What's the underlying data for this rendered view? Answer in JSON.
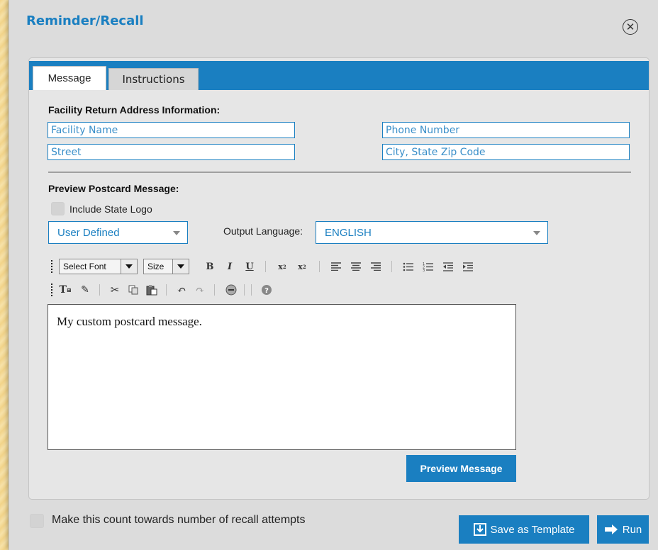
{
  "dialog": {
    "title": "Reminder/Recall",
    "close_icon": "close-circle-icon"
  },
  "tabs": [
    {
      "label": "Message",
      "active": true
    },
    {
      "label": "Instructions",
      "active": false
    }
  ],
  "facility": {
    "section_label": "Facility Return Address Information:",
    "facility_name_placeholder": "Facility Name",
    "phone_placeholder": "Phone Number",
    "street_placeholder": "Street",
    "city_placeholder": "City, State Zip Code"
  },
  "preview": {
    "section_label": "Preview Postcard Message:",
    "include_logo_label": "Include State Logo",
    "include_logo_checked": false,
    "template_select_value": "User Defined",
    "output_language_label": "Output Language:",
    "output_language_value": "ENGLISH"
  },
  "toolbar": {
    "font_select": "Select Font",
    "size_select": "Size",
    "buttons_row1": [
      "bold-icon",
      "italic-icon",
      "underline-icon",
      "subscript-icon",
      "superscript-icon",
      "align-left-icon",
      "align-center-icon",
      "align-right-icon",
      "bullet-list-icon",
      "numbered-list-icon",
      "outdent-icon",
      "indent-icon"
    ],
    "buttons_row2": [
      "text-color-icon",
      "background-color-icon",
      "cut-icon",
      "copy-icon",
      "paste-icon",
      "undo-icon",
      "redo-icon",
      "link-icon",
      "help-icon"
    ]
  },
  "editor": {
    "content": "My custom postcard message."
  },
  "buttons": {
    "preview_message": "Preview Message",
    "save_as_template": "Save as Template",
    "run": "Run"
  },
  "footer": {
    "recall_attempts_label": "Make this count towards number of recall attempts",
    "recall_attempts_checked": false
  },
  "colors": {
    "accent": "#1a7fc1",
    "dialog_bg": "#dcdcdc",
    "panel_bg": "#e6e6e6"
  }
}
